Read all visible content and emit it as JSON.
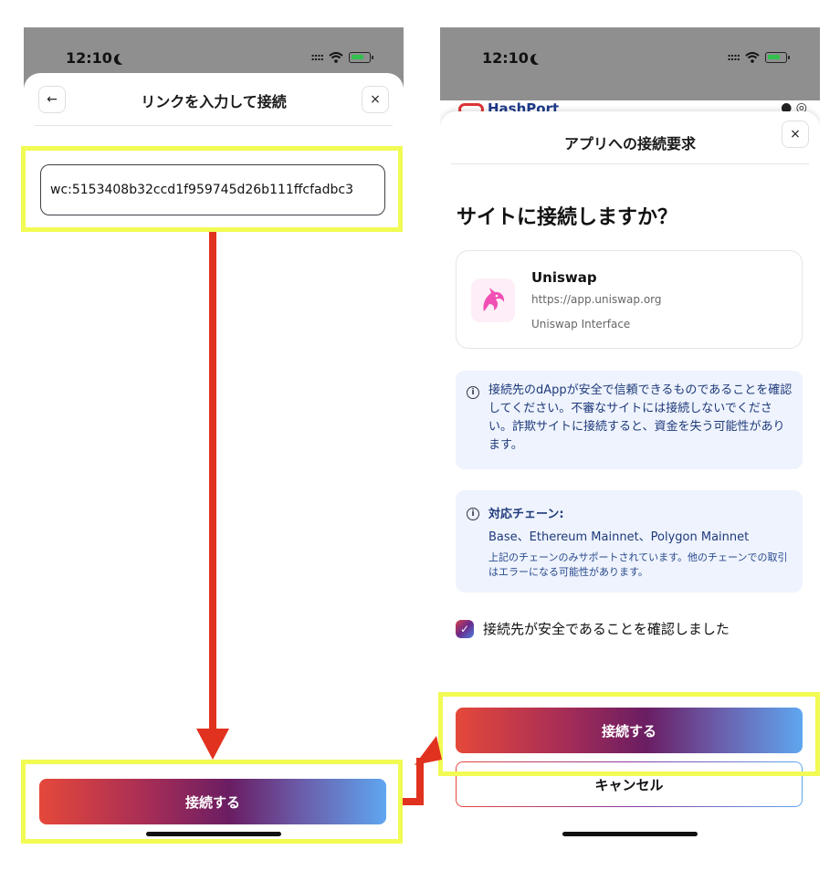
{
  "status": {
    "time": "12:10",
    "signal": "::::"
  },
  "left": {
    "title": "リンクを入力して接続",
    "back_icon": "←",
    "close_icon": "×",
    "wc_value": "wc:5153408b32ccd1f959745d26b111ffcfadbc3",
    "connect_label": "接続する"
  },
  "right": {
    "behind_app": "HashPort",
    "title": "アプリへの接続要求",
    "close_icon": "×",
    "question": "サイトに接続しますか？",
    "app": {
      "name": "Uniswap",
      "url": "https://app.uniswap.org",
      "description": "Uniswap Interface"
    },
    "warning": "接続先のdAppが安全で信頼できるものであることを確認してください。不審なサイトには接続しないでください。詐欺サイトに接続すると、資金を失う可能性があります。",
    "chains": {
      "title": "対応チェーン:",
      "list": "Base、Ethereum Mainnet、Polygon Mainnet",
      "note": "上記のチェーンのみサポートされています。他のチェーンでの取引はエラーになる可能性があります。"
    },
    "confirm_label": "接続先が安全であることを確認しました",
    "connect_label": "接続する",
    "cancel_label": "キャンセル"
  },
  "colors": {
    "highlight": "#f1fb53",
    "arrow": "#e1321f",
    "gradient_start": "#e5483a",
    "gradient_end": "#5fa6f0"
  }
}
